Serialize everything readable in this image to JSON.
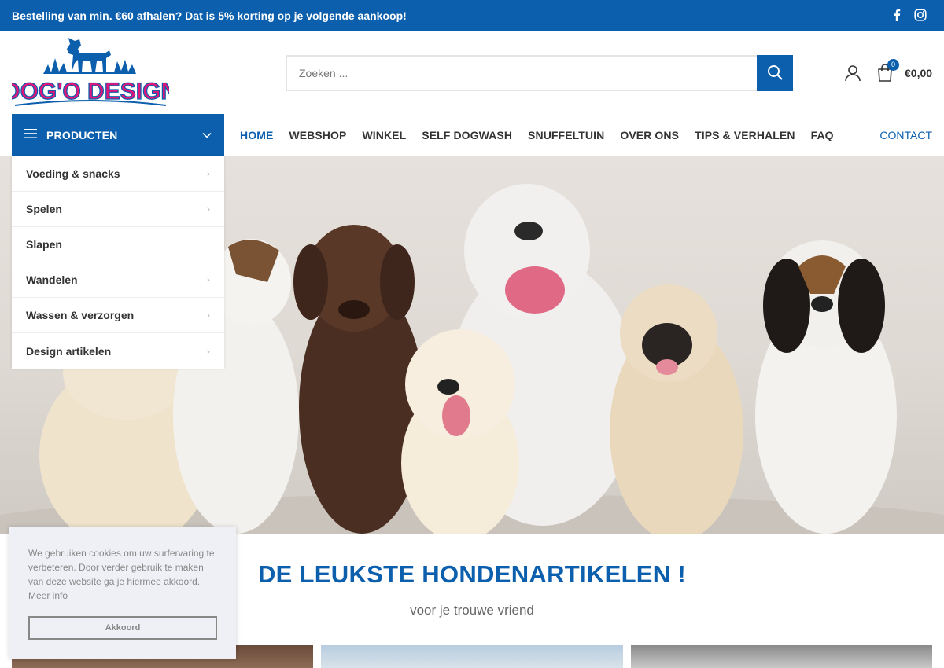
{
  "topbar": {
    "promo": "Bestelling van min. €60 afhalen? Dat is 5% korting op je volgende aankoop!",
    "social_icons": [
      "facebook-icon",
      "instagram-icon"
    ]
  },
  "brand": {
    "logo_text": "DOG'O DESIGN",
    "color_primary": "#0b5fad",
    "color_logo_text": "#e0157a"
  },
  "search": {
    "placeholder": "Zoeken ...",
    "value": ""
  },
  "cart": {
    "count": "0",
    "total": "€0,00"
  },
  "categories": {
    "button_label": "PRODUCTEN",
    "items": [
      {
        "label": "Voeding & snacks",
        "has_sub": true
      },
      {
        "label": "Spelen",
        "has_sub": true
      },
      {
        "label": "Slapen",
        "has_sub": false
      },
      {
        "label": "Wandelen",
        "has_sub": true
      },
      {
        "label": "Wassen & verzorgen",
        "has_sub": true
      },
      {
        "label": "Design artikelen",
        "has_sub": true
      }
    ]
  },
  "nav": {
    "items": [
      {
        "label": "HOME",
        "active": true
      },
      {
        "label": "WEBSHOP",
        "active": false
      },
      {
        "label": "WINKEL",
        "active": false
      },
      {
        "label": "SELF DOGWASH",
        "active": false
      },
      {
        "label": "SNUFFELTUIN",
        "active": false
      },
      {
        "label": "OVER ONS",
        "active": false
      },
      {
        "label": "TIPS & VERHALEN",
        "active": false
      },
      {
        "label": "FAQ",
        "active": false
      }
    ],
    "contact": "CONTACT"
  },
  "section": {
    "title": "DE LEUKSTE HONDENARTIKELEN !",
    "subtitle": "voor je trouwe vriend"
  },
  "cookie": {
    "message": "We gebruiken cookies om uw surfervaring te verbeteren. Door verder gebruik te maken van deze website ga je hiermee akkoord.",
    "more_label": "Meer info",
    "accept_label": "Akkoord"
  }
}
